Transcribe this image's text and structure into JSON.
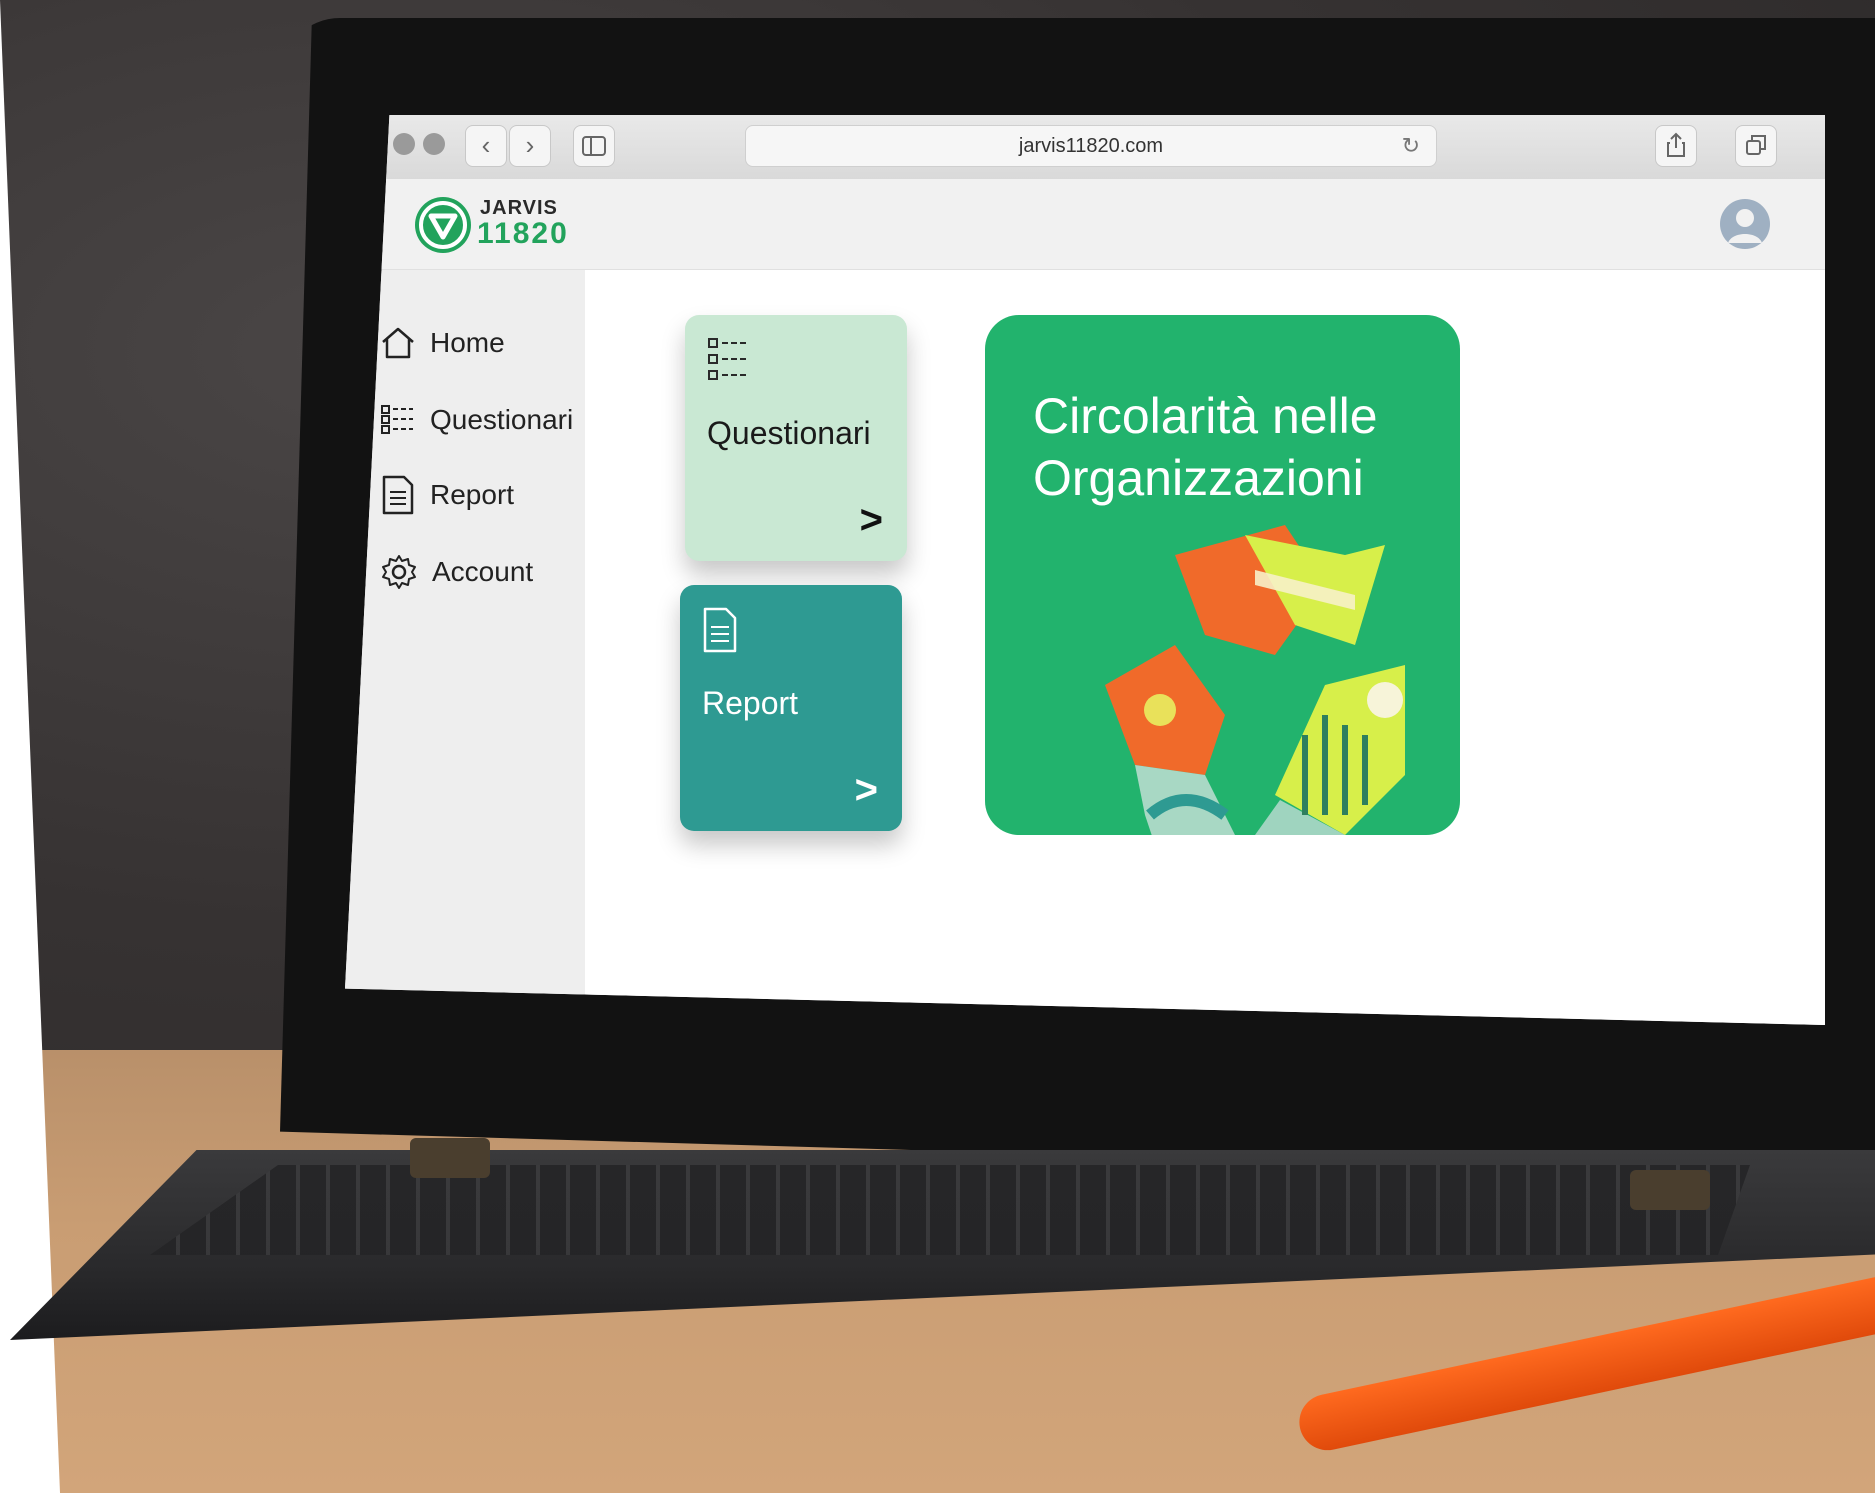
{
  "browser": {
    "url": "jarvis11820.com"
  },
  "app": {
    "logo_top": "JARVIS",
    "logo_bottom": "11820",
    "brand_color": "#22a35c"
  },
  "sidebar": {
    "items": [
      {
        "label": "Home",
        "icon": "home-icon"
      },
      {
        "label": "Questionari",
        "icon": "checklist-icon"
      },
      {
        "label": "Report",
        "icon": "document-icon"
      },
      {
        "label": "Account",
        "icon": "gear-icon"
      }
    ]
  },
  "cards": [
    {
      "label": "Questionari",
      "icon": "checklist-icon",
      "color": "#c9e8d3"
    },
    {
      "label": "Report",
      "icon": "document-icon",
      "color": "#2e9a92"
    }
  ],
  "hero": {
    "line1": "Circolarità nelle",
    "line2": "Organizzazioni",
    "color": "#22b36d"
  }
}
